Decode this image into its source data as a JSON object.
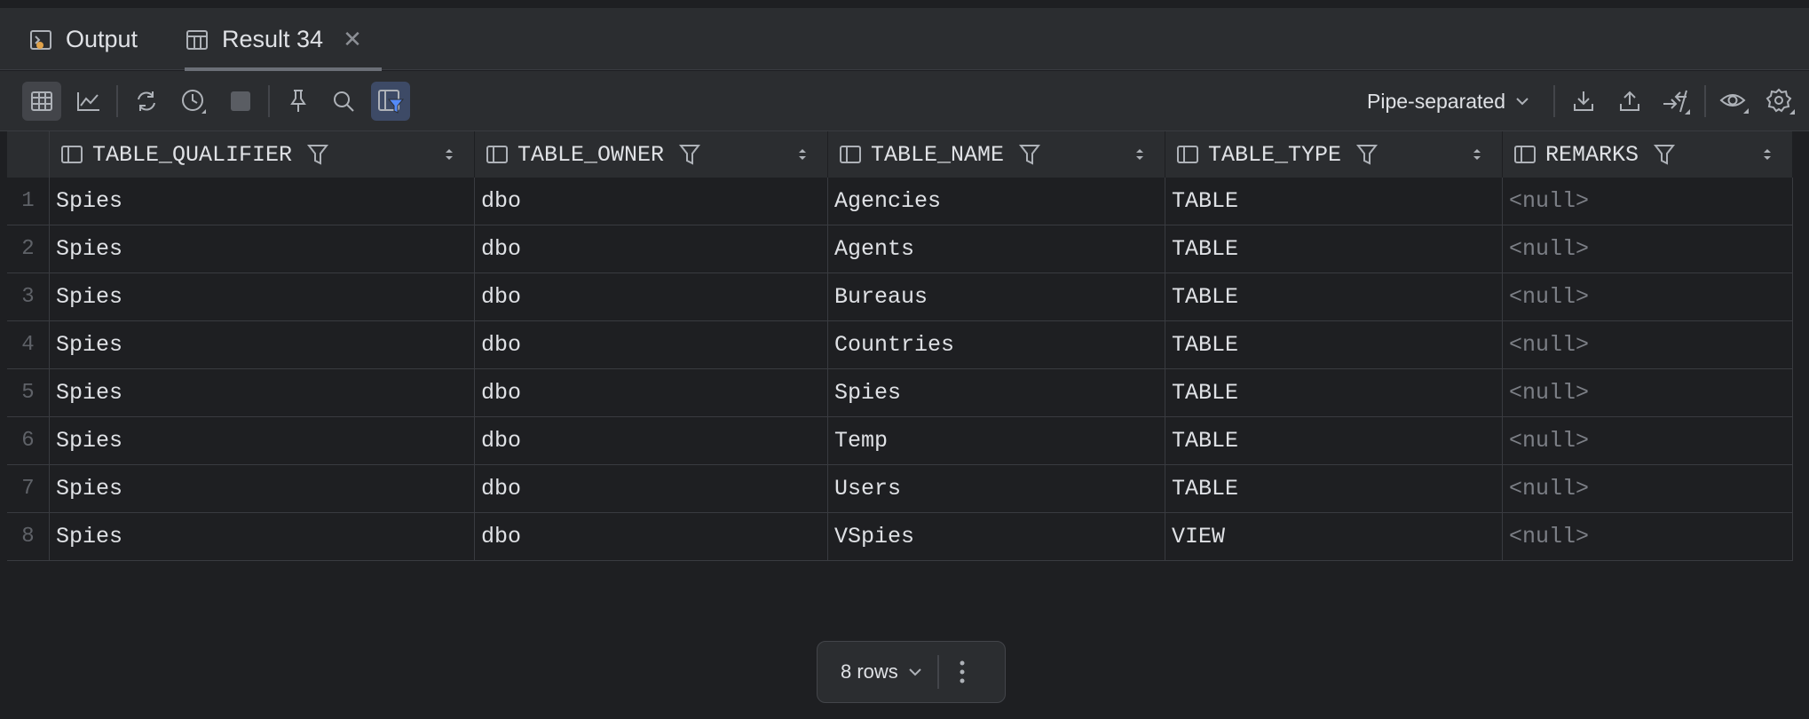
{
  "tabs": [
    {
      "label": "Output",
      "icon": "terminal-output-icon"
    },
    {
      "label": "Result 34",
      "icon": "table-grid-icon",
      "close": "✕"
    }
  ],
  "toolbar": {
    "export_format": "Pipe-separated",
    "icons": [
      "table-view-icon",
      "chart-view-icon",
      "refresh-icon",
      "history-icon",
      "stop-icon",
      "pin-icon",
      "search-icon",
      "filter-toggle-icon",
      "download-icon",
      "upload-icon",
      "compare-icon",
      "view-icon",
      "settings-icon"
    ]
  },
  "table": {
    "columns": [
      "TABLE_QUALIFIER",
      "TABLE_OWNER",
      "TABLE_NAME",
      "TABLE_TYPE",
      "REMARKS"
    ],
    "rows": [
      {
        "n": "1",
        "cells": [
          "Spies",
          "dbo",
          "Agencies",
          "TABLE",
          "<null>"
        ]
      },
      {
        "n": "2",
        "cells": [
          "Spies",
          "dbo",
          "Agents",
          "TABLE",
          "<null>"
        ]
      },
      {
        "n": "3",
        "cells": [
          "Spies",
          "dbo",
          "Bureaus",
          "TABLE",
          "<null>"
        ]
      },
      {
        "n": "4",
        "cells": [
          "Spies",
          "dbo",
          "Countries",
          "TABLE",
          "<null>"
        ]
      },
      {
        "n": "5",
        "cells": [
          "Spies",
          "dbo",
          "Spies",
          "TABLE",
          "<null>"
        ]
      },
      {
        "n": "6",
        "cells": [
          "Spies",
          "dbo",
          "Temp",
          "TABLE",
          "<null>"
        ]
      },
      {
        "n": "7",
        "cells": [
          "Spies",
          "dbo",
          "Users",
          "TABLE",
          "<null>"
        ]
      },
      {
        "n": "8",
        "cells": [
          "Spies",
          "dbo",
          "VSpies",
          "VIEW",
          "<null>"
        ]
      }
    ]
  },
  "footer": {
    "row_count": "8 rows"
  },
  "colors": {
    "background": "#1e1f22",
    "panel": "#2b2d30",
    "accent_filter": "#548af7",
    "null_text": "#7c7f86"
  }
}
